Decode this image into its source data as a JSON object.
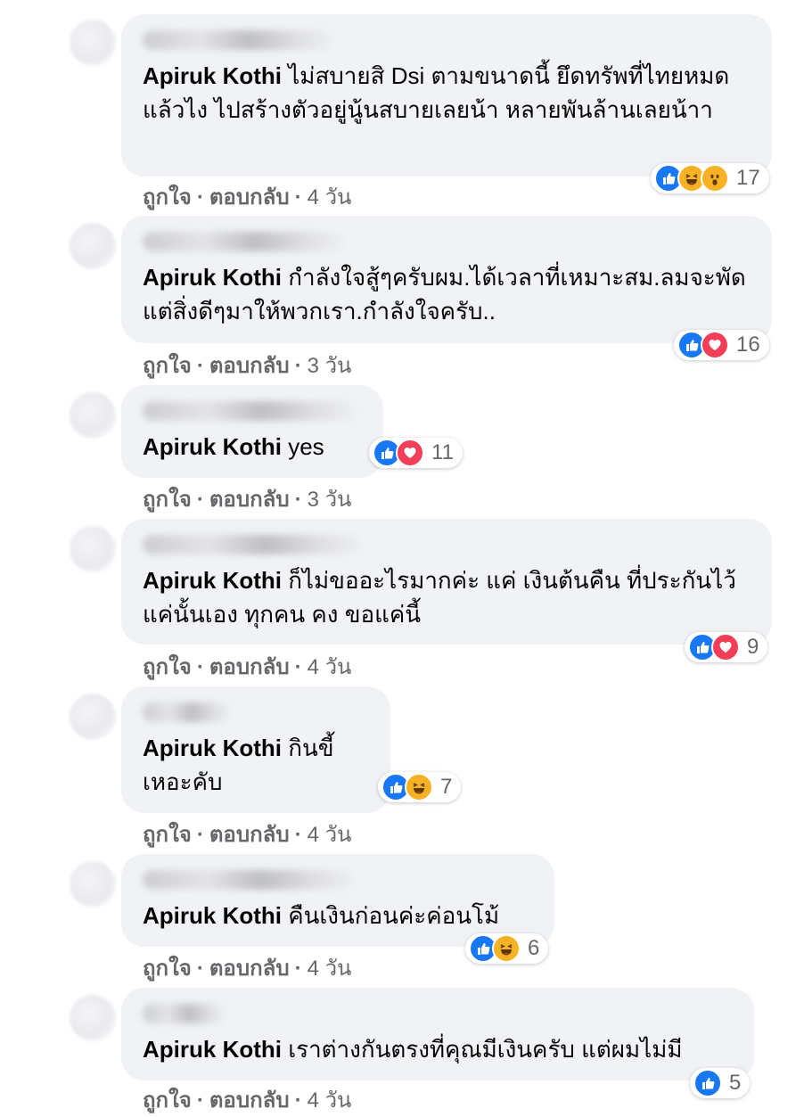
{
  "labels": {
    "like": "ถูกใจ",
    "reply": "ตอบกลับ",
    "separator": "·"
  },
  "colors": {
    "bubble": "#f0f2f5",
    "meta": "#65676b",
    "like": "#1877f2",
    "love": "#f33e58",
    "haha": "#f7b125"
  },
  "comments": [
    {
      "mention": "Apiruk Kothi",
      "text": " ไม่สบายสิ Dsi ตามขนาดนี้ ยึดทรัพที่ไทยหมดแล้วไง ไปสร้างตัวอยู่นู้นสบายเลยน้า หลายพันล้านเลยน้าา",
      "time": "4 วัน",
      "reactions": [
        "like",
        "haha",
        "wow"
      ],
      "count": "17"
    },
    {
      "mention": "Apiruk Kothi",
      "text": " กำลังใจสู้ๆครับผม.ได้เวลาที่เหมาะสม.ลมจะพัดแต่สิ่งดีๆมาให้พวกเรา.กำลังใจครับ..",
      "time": "3 วัน",
      "reactions": [
        "like",
        "love"
      ],
      "count": "16"
    },
    {
      "mention": "Apiruk Kothi",
      "text": " yes",
      "time": "3 วัน",
      "reactions": [
        "like",
        "love"
      ],
      "count": "11"
    },
    {
      "mention": "Apiruk Kothi",
      "text": " ก็ไม่ขออะไรมากค่ะ แค่ เงินต้นคืน ที่ประกันไว้ แค่นั้นเอง ทุกคน คง ขอแค่นี้",
      "time": "4 วัน",
      "reactions": [
        "like",
        "love"
      ],
      "count": "9"
    },
    {
      "mention": "Apiruk Kothi",
      "text": " กินขี้เหอะคับ",
      "time": "4 วัน",
      "reactions": [
        "like",
        "haha"
      ],
      "count": "7"
    },
    {
      "mention": "Apiruk Kothi",
      "text": " คืนเงินก่อนค่ะค่อนโม้",
      "time": "4 วัน",
      "reactions": [
        "like",
        "haha"
      ],
      "count": "6"
    },
    {
      "mention": "Apiruk Kothi",
      "text": " เราต่างกันตรงที่คุณมีเงินครับ แต่ผมไม่มี",
      "time": "4 วัน",
      "reactions": [
        "like"
      ],
      "count": "5"
    }
  ]
}
